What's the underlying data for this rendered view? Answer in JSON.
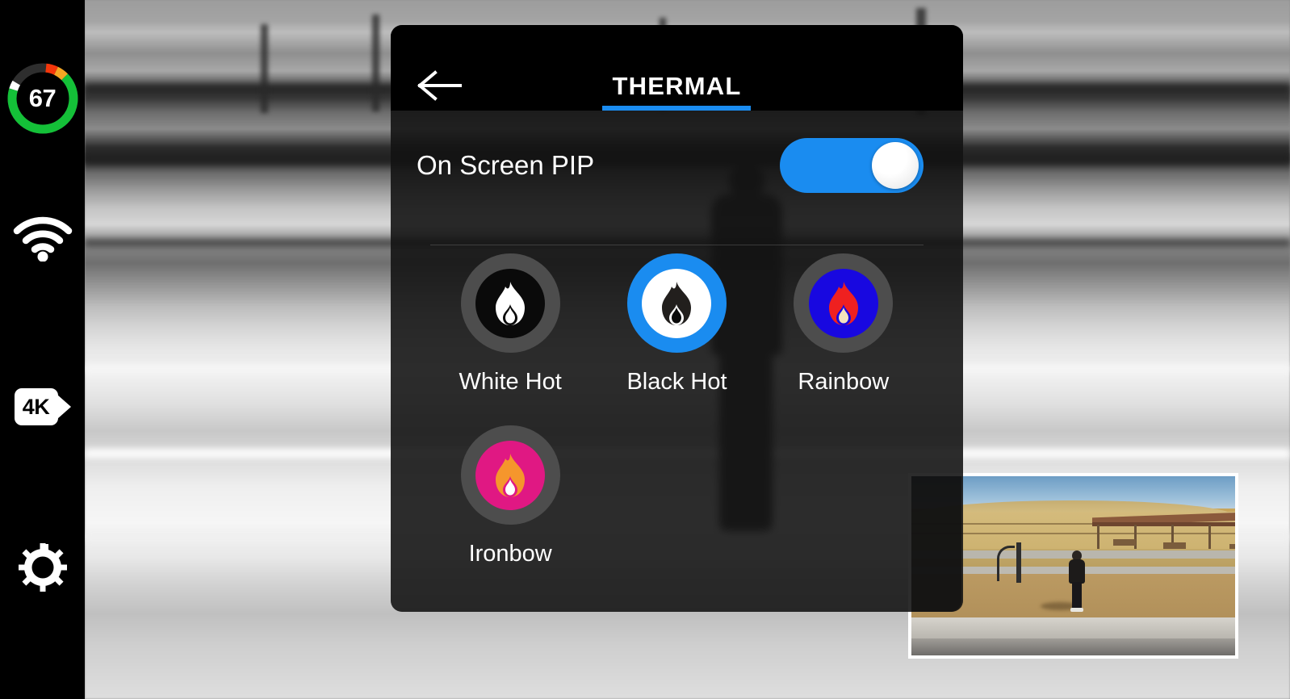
{
  "sidebar": {
    "battery": {
      "name": "battery-gauge",
      "value": "67",
      "percent": 67,
      "colors": {
        "charge": "#14c038",
        "warn_orange": "#f5a623",
        "warn_red": "#f5360a",
        "track": "#2e2e2e",
        "tip": "#ffffff"
      }
    },
    "wifi": {
      "name": "wifi-icon",
      "label": "WiFi"
    },
    "resolution": {
      "name": "4k-video-icon",
      "label": "4K"
    },
    "settings": {
      "name": "gear-icon",
      "label": "Settings"
    }
  },
  "panel": {
    "title": "THERMAL",
    "back_label": "Back",
    "accent": "#1a8cf0",
    "pip": {
      "label": "On Screen PIP",
      "toggle_state": "on",
      "toggle_on_color": "#1a8cf0"
    },
    "modes": [
      {
        "id": "white-hot",
        "label": "White Hot",
        "selected": false,
        "ring_color": "#4d4d4d",
        "inner_color": "#0a0a0a",
        "flame_outer": "#ffffff",
        "flame_inner": "#ffffff"
      },
      {
        "id": "black-hot",
        "label": "Black Hot",
        "selected": true,
        "ring_color": "#1a8cf0",
        "inner_color": "#ffffff",
        "flame_outer": "#221f1d",
        "flame_inner": "#0a0a0a"
      },
      {
        "id": "rainbow",
        "label": "Rainbow",
        "selected": false,
        "ring_color": "#4d4d4d",
        "inner_color": "#1808e0",
        "flame_outer": "#ef2020",
        "flame_inner": "#f2e2bd"
      },
      {
        "id": "ironbow",
        "label": "Ironbow",
        "selected": false,
        "ring_color": "#4d4d4d",
        "inner_color": "#e01883",
        "flame_outer": "#f5962c",
        "flame_inner": "#ffffff"
      }
    ]
  },
  "pip_preview": {
    "name": "picture-in-picture-preview",
    "description": "Color camera view: blue sky, dry golden field, covered shelter with benches, person standing on dirt, concrete walkway"
  },
  "background": {
    "name": "thermal-camera-feed",
    "mode": "black-hot-grayscale"
  }
}
